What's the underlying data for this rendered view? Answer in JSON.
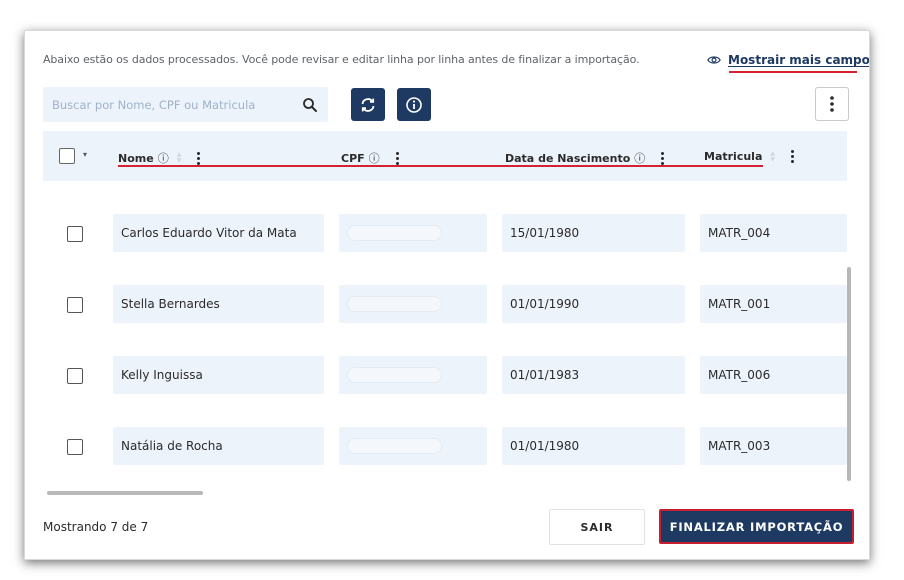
{
  "header": {
    "intro": "Abaixo estão os dados processados. Você pode revisar e editar linha por linha antes de finalizar a importação.",
    "more_fields": "Mostrair mais campos"
  },
  "search": {
    "placeholder": "Buscar por Nome, CPF ou Matricula"
  },
  "table": {
    "columns": [
      {
        "label": "Nome",
        "help": "?"
      },
      {
        "label": "CPF",
        "help": "?"
      },
      {
        "label": "Data de Nascimento",
        "help": "?"
      },
      {
        "label": "Matricula"
      }
    ],
    "rows": [
      {
        "nome": "Carlos Eduardo Vitor da Mata",
        "nascimento": "15/01/1980",
        "matricula": "MATR_004"
      },
      {
        "nome": "Stella Bernardes",
        "nascimento": "01/01/1990",
        "matricula": "MATR_001"
      },
      {
        "nome": "Kelly Inguissa",
        "nascimento": "01/01/1983",
        "matricula": "MATR_006"
      },
      {
        "nome": "Natália de Rocha",
        "nascimento": "01/01/1980",
        "matricula": "MATR_003"
      }
    ]
  },
  "footer": {
    "count": "Mostrando 7 de 7",
    "exit_label": "SAIR",
    "finalize_label": "FINALIZAR IMPORTAÇÃO"
  },
  "colors": {
    "primary": "#1e3a63",
    "highlight": "#d42232",
    "cell_bg": "#edf3fb"
  },
  "icons": [
    "eye-icon",
    "search-icon",
    "refresh-icon",
    "info-icon",
    "kebab-menu-icon",
    "help-circle-icon",
    "sort-icon",
    "chevron-down-icon"
  ]
}
